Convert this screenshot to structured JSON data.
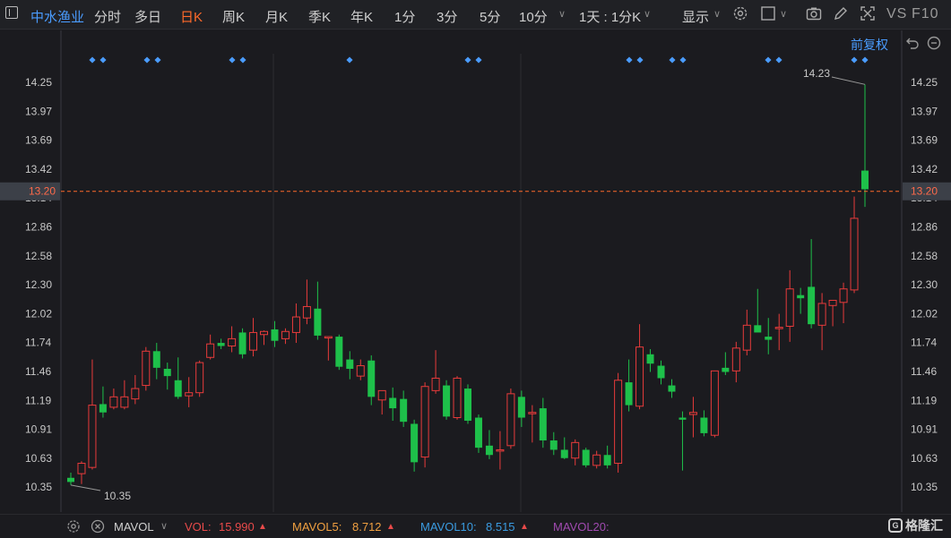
{
  "toolbar": {
    "stock_name": "中水渔业",
    "periods": [
      {
        "label": "分时",
        "active": false
      },
      {
        "label": "多日",
        "active": false
      },
      {
        "label": "日K",
        "active": true
      },
      {
        "label": "周K",
        "active": false
      },
      {
        "label": "月K",
        "active": false
      },
      {
        "label": "季K",
        "active": false
      },
      {
        "label": "年K",
        "active": false
      },
      {
        "label": "1分",
        "active": false
      },
      {
        "label": "3分",
        "active": false
      },
      {
        "label": "5分",
        "active": false
      },
      {
        "label": "10分",
        "active": false
      }
    ],
    "interval_select": "1天 : 1分K",
    "show_label": "显示",
    "vs_label": "VS",
    "f10_label": "F10"
  },
  "chart": {
    "adjust_label": "前复权",
    "price_ticks": [
      "14.25",
      "13.97",
      "13.69",
      "13.42",
      "13.14",
      "12.86",
      "12.58",
      "12.30",
      "12.02",
      "11.74",
      "11.46",
      "11.19",
      "10.91",
      "10.63",
      "10.35"
    ],
    "current_price": "13.20",
    "max_label": "14.23",
    "min_label": "10.35",
    "colors": {
      "up": "#e83b3b",
      "down": "#1ec04a",
      "marker": "#4a9cff",
      "current": "#ff6a2a"
    }
  },
  "chart_data": {
    "type": "candlestick",
    "ylim": [
      10.22,
      14.38
    ],
    "current_price": 13.2,
    "candles": [
      {
        "o": 10.44,
        "h": 10.49,
        "l": 10.37,
        "c": 10.4
      },
      {
        "o": 10.48,
        "h": 10.6,
        "l": 10.38,
        "c": 10.58
      },
      {
        "o": 10.54,
        "h": 11.58,
        "l": 10.52,
        "c": 11.14
      },
      {
        "o": 11.15,
        "h": 11.32,
        "l": 11.02,
        "c": 11.07
      },
      {
        "o": 11.12,
        "h": 11.3,
        "l": 11.1,
        "c": 11.22
      },
      {
        "o": 11.12,
        "h": 11.38,
        "l": 11.1,
        "c": 11.22
      },
      {
        "o": 11.2,
        "h": 11.43,
        "l": 11.15,
        "c": 11.3
      },
      {
        "o": 11.33,
        "h": 11.7,
        "l": 11.28,
        "c": 11.66
      },
      {
        "o": 11.66,
        "h": 11.74,
        "l": 11.39,
        "c": 11.5
      },
      {
        "o": 11.49,
        "h": 11.55,
        "l": 11.29,
        "c": 11.42
      },
      {
        "o": 11.38,
        "h": 11.6,
        "l": 11.2,
        "c": 11.22
      },
      {
        "o": 11.23,
        "h": 11.41,
        "l": 11.12,
        "c": 11.26
      },
      {
        "o": 11.26,
        "h": 11.57,
        "l": 11.22,
        "c": 11.55
      },
      {
        "o": 11.6,
        "h": 11.82,
        "l": 11.58,
        "c": 11.73
      },
      {
        "o": 11.74,
        "h": 11.78,
        "l": 11.68,
        "c": 11.71
      },
      {
        "o": 11.71,
        "h": 11.9,
        "l": 11.65,
        "c": 11.78
      },
      {
        "o": 11.84,
        "h": 11.88,
        "l": 11.59,
        "c": 11.63
      },
      {
        "o": 11.67,
        "h": 11.98,
        "l": 11.61,
        "c": 11.84
      },
      {
        "o": 11.82,
        "h": 11.86,
        "l": 11.72,
        "c": 11.85
      },
      {
        "o": 11.87,
        "h": 11.95,
        "l": 11.7,
        "c": 11.76
      },
      {
        "o": 11.78,
        "h": 11.88,
        "l": 11.73,
        "c": 11.85
      },
      {
        "o": 11.84,
        "h": 12.12,
        "l": 11.74,
        "c": 11.99
      },
      {
        "o": 11.98,
        "h": 12.35,
        "l": 11.92,
        "c": 12.09
      },
      {
        "o": 12.07,
        "h": 12.33,
        "l": 11.77,
        "c": 11.81
      },
      {
        "o": 11.8,
        "h": 11.8,
        "l": 11.57,
        "c": 11.8
      },
      {
        "o": 11.8,
        "h": 11.82,
        "l": 11.48,
        "c": 11.51
      },
      {
        "o": 11.58,
        "h": 11.66,
        "l": 11.39,
        "c": 11.49
      },
      {
        "o": 11.42,
        "h": 11.58,
        "l": 11.38,
        "c": 11.52
      },
      {
        "o": 11.57,
        "h": 11.62,
        "l": 11.14,
        "c": 11.22
      },
      {
        "o": 11.19,
        "h": 11.27,
        "l": 11.05,
        "c": 11.28
      },
      {
        "o": 11.21,
        "h": 11.31,
        "l": 10.99,
        "c": 11.11
      },
      {
        "o": 11.2,
        "h": 11.28,
        "l": 10.93,
        "c": 10.98
      },
      {
        "o": 10.96,
        "h": 11.0,
        "l": 10.5,
        "c": 10.59
      },
      {
        "o": 10.64,
        "h": 11.36,
        "l": 10.54,
        "c": 11.32
      },
      {
        "o": 11.28,
        "h": 11.67,
        "l": 11.25,
        "c": 11.4
      },
      {
        "o": 11.33,
        "h": 11.38,
        "l": 11.0,
        "c": 11.03
      },
      {
        "o": 11.02,
        "h": 11.42,
        "l": 11.0,
        "c": 11.4
      },
      {
        "o": 11.3,
        "h": 11.34,
        "l": 10.96,
        "c": 10.99
      },
      {
        "o": 11.02,
        "h": 11.05,
        "l": 10.68,
        "c": 10.73
      },
      {
        "o": 10.75,
        "h": 10.9,
        "l": 10.62,
        "c": 10.66
      },
      {
        "o": 10.71,
        "h": 10.89,
        "l": 10.52,
        "c": 10.71
      },
      {
        "o": 10.75,
        "h": 11.3,
        "l": 10.72,
        "c": 11.25
      },
      {
        "o": 11.22,
        "h": 11.28,
        "l": 10.93,
        "c": 11.02
      },
      {
        "o": 11.06,
        "h": 11.14,
        "l": 10.78,
        "c": 11.07
      },
      {
        "o": 11.11,
        "h": 11.21,
        "l": 10.73,
        "c": 10.8
      },
      {
        "o": 10.8,
        "h": 10.88,
        "l": 10.66,
        "c": 10.71
      },
      {
        "o": 10.71,
        "h": 10.83,
        "l": 10.62,
        "c": 10.63
      },
      {
        "o": 10.63,
        "h": 10.81,
        "l": 10.56,
        "c": 10.78
      },
      {
        "o": 10.71,
        "h": 10.73,
        "l": 10.54,
        "c": 10.56
      },
      {
        "o": 10.56,
        "h": 10.7,
        "l": 10.53,
        "c": 10.66
      },
      {
        "o": 10.66,
        "h": 10.75,
        "l": 10.53,
        "c": 10.56
      },
      {
        "o": 10.58,
        "h": 11.45,
        "l": 10.49,
        "c": 11.38
      },
      {
        "o": 11.36,
        "h": 11.58,
        "l": 11.08,
        "c": 11.14
      },
      {
        "o": 11.13,
        "h": 11.92,
        "l": 11.1,
        "c": 11.7
      },
      {
        "o": 11.63,
        "h": 11.68,
        "l": 11.46,
        "c": 11.54
      },
      {
        "o": 11.52,
        "h": 11.57,
        "l": 11.34,
        "c": 11.4
      },
      {
        "o": 11.33,
        "h": 11.39,
        "l": 11.21,
        "c": 11.27
      },
      {
        "o": 11.02,
        "h": 11.08,
        "l": 10.51,
        "c": 11.0
      },
      {
        "o": 11.05,
        "h": 11.22,
        "l": 10.83,
        "c": 11.07
      },
      {
        "o": 11.02,
        "h": 11.09,
        "l": 10.84,
        "c": 10.87
      },
      {
        "o": 10.85,
        "h": 11.47,
        "l": 10.83,
        "c": 11.47
      },
      {
        "o": 11.5,
        "h": 11.65,
        "l": 11.43,
        "c": 11.46
      },
      {
        "o": 11.47,
        "h": 11.75,
        "l": 11.36,
        "c": 11.69
      },
      {
        "o": 11.67,
        "h": 12.06,
        "l": 11.62,
        "c": 11.91
      },
      {
        "o": 11.91,
        "h": 12.26,
        "l": 11.86,
        "c": 11.84
      },
      {
        "o": 11.8,
        "h": 11.98,
        "l": 11.63,
        "c": 11.77
      },
      {
        "o": 11.88,
        "h": 12.02,
        "l": 11.67,
        "c": 11.89
      },
      {
        "o": 11.9,
        "h": 12.44,
        "l": 11.75,
        "c": 12.26
      },
      {
        "o": 12.2,
        "h": 12.27,
        "l": 12.02,
        "c": 12.17
      },
      {
        "o": 12.28,
        "h": 12.74,
        "l": 11.88,
        "c": 11.92
      },
      {
        "o": 11.91,
        "h": 12.22,
        "l": 11.67,
        "c": 12.12
      },
      {
        "o": 12.1,
        "h": 12.15,
        "l": 11.9,
        "c": 12.15
      },
      {
        "o": 12.13,
        "h": 12.32,
        "l": 11.93,
        "c": 12.26
      },
      {
        "o": 12.25,
        "h": 13.15,
        "l": 12.22,
        "c": 12.94
      },
      {
        "o": 13.4,
        "h": 14.23,
        "l": 13.05,
        "c": 13.22
      }
    ],
    "markers_x": [
      103,
      115,
      164,
      176,
      259,
      271,
      390,
      522,
      534,
      702,
      714,
      750,
      762,
      857,
      869,
      953,
      965
    ]
  },
  "indicators": {
    "mavol_label": "MAVOL",
    "vol": {
      "label": "VOL:",
      "value": "15.990",
      "arrow": "▲"
    },
    "mavol5": {
      "label": "MAVOL5:",
      "value": "8.712",
      "arrow": "▲"
    },
    "mavol10": {
      "label": "MAVOL10:",
      "value": "8.515",
      "arrow": "▲"
    },
    "mavol20": {
      "label": "MAVOL20:"
    }
  },
  "brand": {
    "logo_text": "格隆汇",
    "mark": "G"
  }
}
